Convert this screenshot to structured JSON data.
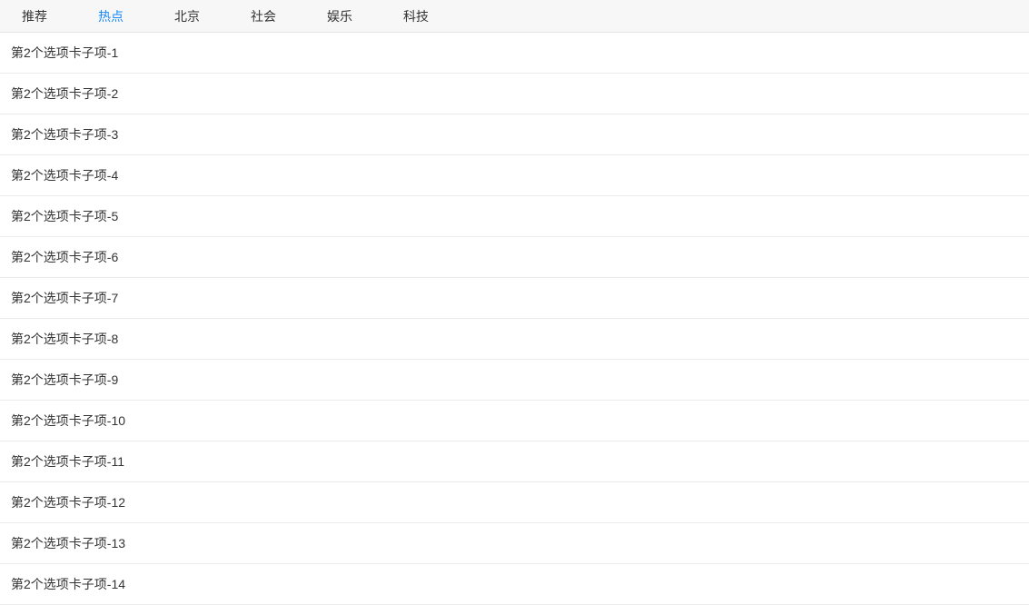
{
  "tabs": [
    {
      "label": "推荐",
      "active": false
    },
    {
      "label": "热点",
      "active": true
    },
    {
      "label": "北京",
      "active": false
    },
    {
      "label": "社会",
      "active": false
    },
    {
      "label": "娱乐",
      "active": false
    },
    {
      "label": "科技",
      "active": false
    }
  ],
  "list": {
    "items": [
      {
        "text": "第2个选项卡子项-1"
      },
      {
        "text": "第2个选项卡子项-2"
      },
      {
        "text": "第2个选项卡子项-3"
      },
      {
        "text": "第2个选项卡子项-4"
      },
      {
        "text": "第2个选项卡子项-5"
      },
      {
        "text": "第2个选项卡子项-6"
      },
      {
        "text": "第2个选项卡子项-7"
      },
      {
        "text": "第2个选项卡子项-8"
      },
      {
        "text": "第2个选项卡子项-9"
      },
      {
        "text": "第2个选项卡子项-10"
      },
      {
        "text": "第2个选项卡子项-11"
      },
      {
        "text": "第2个选项卡子项-12"
      },
      {
        "text": "第2个选项卡子项-13"
      },
      {
        "text": "第2个选项卡子项-14"
      }
    ]
  }
}
